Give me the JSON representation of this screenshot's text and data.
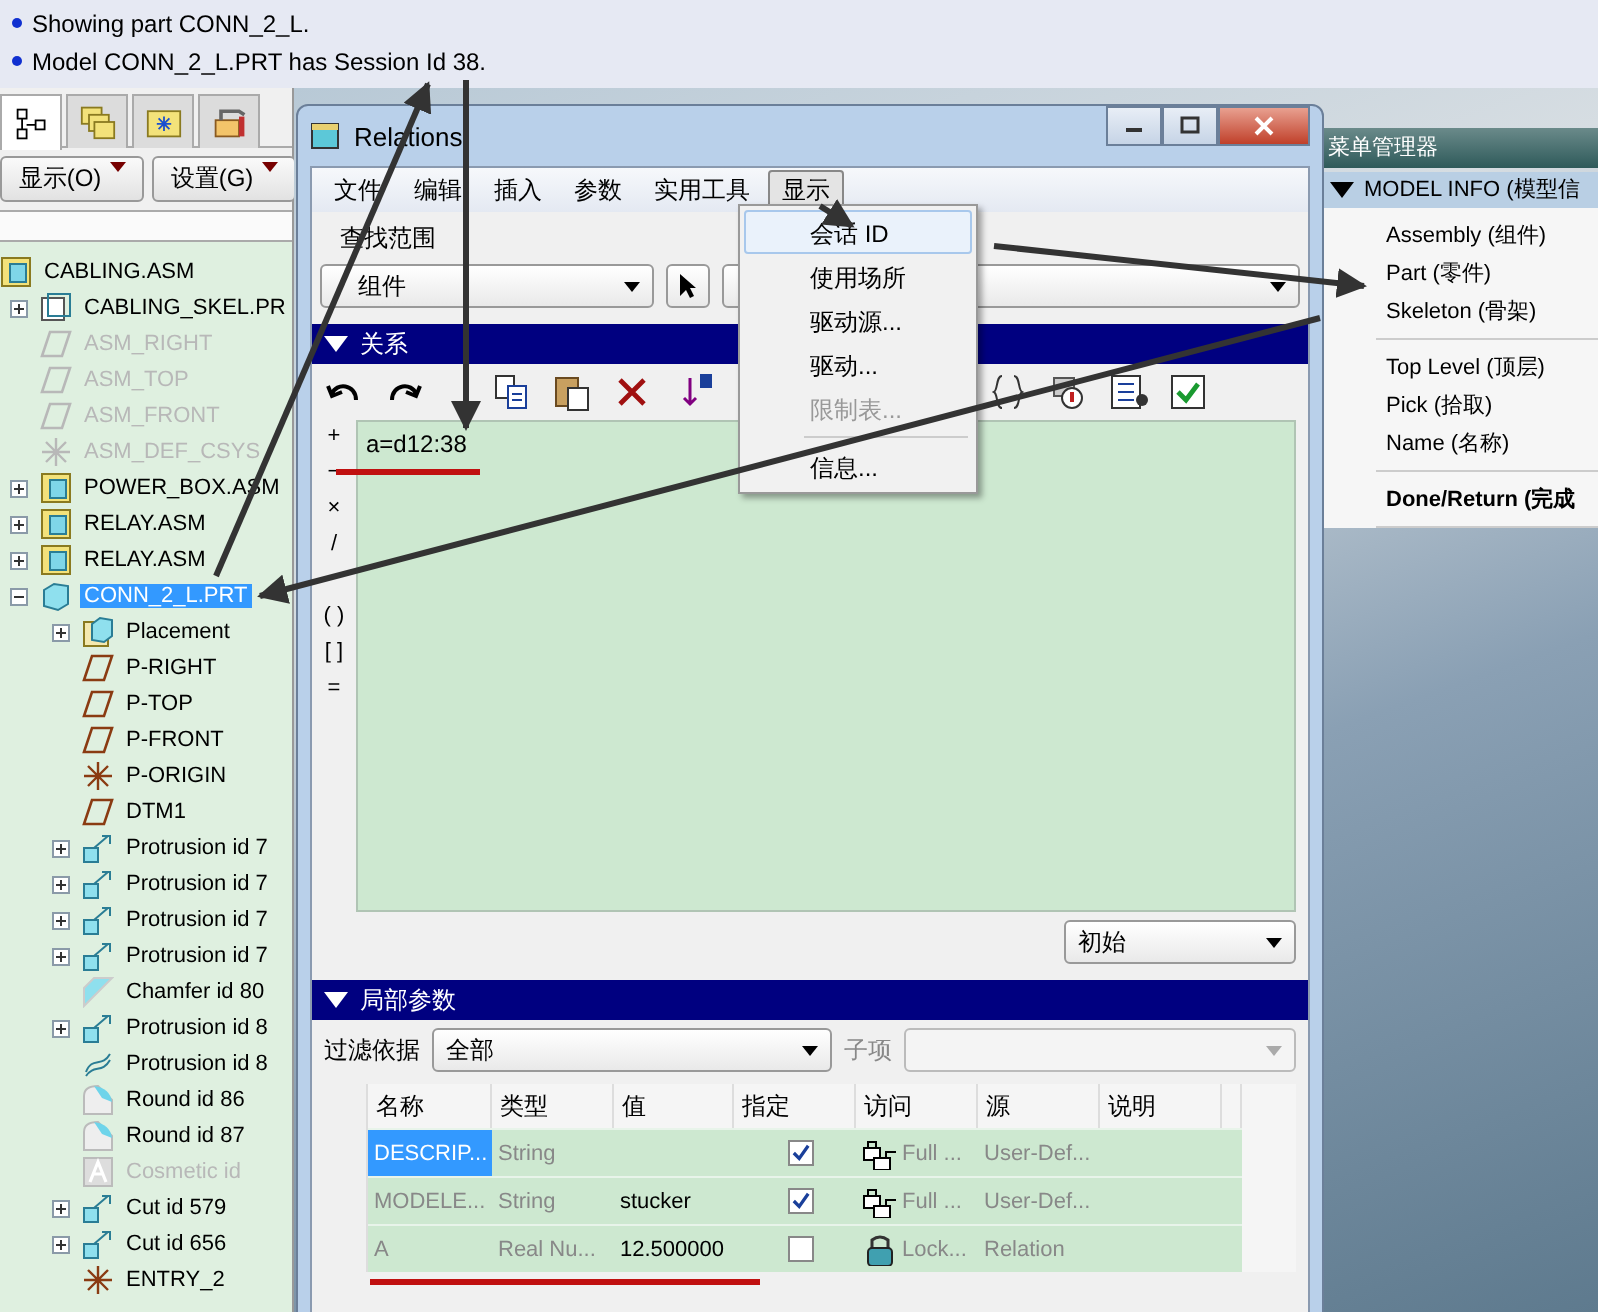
{
  "messages": [
    "Showing part CONN_2_L.",
    "Model CONN_2_L.PRT has Session Id 38."
  ],
  "model_tree": {
    "tabs": [
      {
        "kind": "tree",
        "selected": true
      },
      {
        "kind": "layers",
        "selected": false
      },
      {
        "kind": "favorites",
        "selected": false
      },
      {
        "kind": "tools",
        "selected": false
      }
    ],
    "buttons": [
      "显示(O)",
      "设置(G)"
    ],
    "items": [
      {
        "label": "CABLING.ASM",
        "kind": "asm",
        "selected": false,
        "disabled": false,
        "children": [
          {
            "label": "CABLING_SKEL.PR",
            "kind": "skeleton",
            "expandable": true,
            "expanded": false,
            "selected": false,
            "disabled": false
          },
          {
            "label": "ASM_RIGHT",
            "kind": "plane",
            "selected": false,
            "disabled": true
          },
          {
            "label": "ASM_TOP",
            "kind": "plane",
            "selected": false,
            "disabled": true
          },
          {
            "label": "ASM_FRONT",
            "kind": "plane",
            "selected": false,
            "disabled": true
          },
          {
            "label": "ASM_DEF_CSYS",
            "kind": "csys",
            "selected": false,
            "disabled": true
          },
          {
            "label": "POWER_BOX.ASM",
            "kind": "asm",
            "expandable": true,
            "expanded": false,
            "selected": false,
            "disabled": false
          },
          {
            "label": "RELAY.ASM",
            "kind": "asm",
            "expandable": true,
            "expanded": false,
            "selected": false,
            "disabled": false
          },
          {
            "label": "RELAY.ASM",
            "kind": "asm",
            "expandable": true,
            "expanded": false,
            "selected": false,
            "disabled": false
          },
          {
            "label": "CONN_2_L.PRT",
            "kind": "part",
            "expandable": true,
            "expanded": true,
            "selected": true,
            "disabled": false,
            "children": [
              {
                "label": "Placement",
                "kind": "placement",
                "expandable": true,
                "expanded": false,
                "selected": false,
                "disabled": false
              },
              {
                "label": "P-RIGHT",
                "kind": "plane",
                "selected": false,
                "disabled": false
              },
              {
                "label": "P-TOP",
                "kind": "plane",
                "selected": false,
                "disabled": false
              },
              {
                "label": "P-FRONT",
                "kind": "plane",
                "selected": false,
                "disabled": false
              },
              {
                "label": "P-ORIGIN",
                "kind": "csys",
                "selected": false,
                "disabled": false
              },
              {
                "label": "DTM1",
                "kind": "plane",
                "selected": false,
                "disabled": false
              },
              {
                "label": "Protrusion id 7",
                "kind": "protrusion",
                "expandable": true,
                "expanded": false,
                "selected": false,
                "disabled": false
              },
              {
                "label": "Protrusion id 7",
                "kind": "protrusion",
                "expandable": true,
                "expanded": false,
                "selected": false,
                "disabled": false
              },
              {
                "label": "Protrusion id 7",
                "kind": "protrusion",
                "expandable": true,
                "expanded": false,
                "selected": false,
                "disabled": false
              },
              {
                "label": "Protrusion id 7",
                "kind": "protrusion",
                "expandable": true,
                "expanded": false,
                "selected": false,
                "disabled": false
              },
              {
                "label": "Chamfer id 80",
                "kind": "chamfer",
                "selected": false,
                "disabled": false
              },
              {
                "label": "Protrusion id 8",
                "kind": "protrusion",
                "expandable": true,
                "expanded": false,
                "selected": false,
                "disabled": false
              },
              {
                "label": "Protrusion id 8",
                "kind": "sweep",
                "selected": false,
                "disabled": false
              },
              {
                "label": "Round id 86",
                "kind": "round",
                "selected": false,
                "disabled": false
              },
              {
                "label": "Round id 87",
                "kind": "round",
                "selected": false,
                "disabled": false
              },
              {
                "label": "Cosmetic id",
                "kind": "cosmetic",
                "selected": false,
                "disabled": true
              },
              {
                "label": "Cut id 579",
                "kind": "cut",
                "expandable": true,
                "expanded": false,
                "selected": false,
                "disabled": false
              },
              {
                "label": "Cut id 656",
                "kind": "cut",
                "expandable": true,
                "expanded": false,
                "selected": false,
                "disabled": false
              },
              {
                "label": "ENTRY_2",
                "kind": "csys",
                "selected": false,
                "disabled": false
              }
            ]
          }
        ]
      }
    ]
  },
  "relations_dialog": {
    "title": "Relations",
    "menu": [
      {
        "label": "文件",
        "selected": false
      },
      {
        "label": "编辑",
        "selected": false
      },
      {
        "label": "插入",
        "selected": false
      },
      {
        "label": "参数",
        "selected": false
      },
      {
        "label": "实用工具",
        "selected": false
      },
      {
        "label": "显示",
        "selected": true
      }
    ],
    "lookup": {
      "label": "查找范围",
      "scope": "组件"
    },
    "relations_section": {
      "title": "关系",
      "expanded": true
    },
    "operators": [
      "+",
      "−",
      "×",
      "/",
      "( )",
      "[ ]",
      "="
    ],
    "relations_text": "a=d12:38",
    "mode": "初始",
    "params_section": {
      "title": "局部参数",
      "expanded": true
    },
    "filter": {
      "label": "过滤依据",
      "value": "全部",
      "sub_label": "子项"
    },
    "table": {
      "columns": [
        "名称",
        "类型",
        "值",
        "指定",
        "访问",
        "源",
        "说明"
      ],
      "rows": [
        {
          "name": "DESCRIP...",
          "type": "String",
          "designated": true,
          "access": "Full ...",
          "kind": "full",
          "source": "User-Def...",
          "selected": true
        },
        {
          "name": "MODELE...",
          "type": "String",
          "value": "stucker",
          "designated": true,
          "access": "Full ...",
          "kind": "full",
          "source": "User-Def...",
          "selected": false
        },
        {
          "name": "A",
          "type": "Real Nu...",
          "value": "12.500000",
          "designated": false,
          "access": "Lock...",
          "kind": "locked",
          "source": "Relation",
          "selected": false
        }
      ]
    }
  },
  "show_menu": {
    "items": [
      {
        "kind": "item",
        "label": "会话 ID",
        "selected": true,
        "disabled": false
      },
      {
        "kind": "item",
        "label": "使用场所",
        "selected": false,
        "disabled": false
      },
      {
        "kind": "item",
        "label": "驱动源...",
        "selected": false,
        "disabled": false
      },
      {
        "kind": "item",
        "label": "驱动...",
        "selected": false,
        "disabled": false
      },
      {
        "kind": "item",
        "label": "限制表...",
        "selected": false,
        "disabled": true
      },
      {
        "kind": "separator"
      },
      {
        "kind": "item",
        "label": "信息...",
        "selected": false,
        "disabled": false
      }
    ]
  },
  "menu_manager": {
    "title": "菜单管理器",
    "header": "MODEL INFO (模型信",
    "groups": [
      [
        {
          "kind": "option",
          "label": "Assembly (组件)"
        },
        {
          "kind": "option",
          "label": "Part (零件)"
        },
        {
          "kind": "option",
          "label": "Skeleton (骨架)"
        }
      ],
      [
        {
          "kind": "option",
          "label": "Top Level (顶层)"
        },
        {
          "kind": "option",
          "label": "Pick (拾取)"
        },
        {
          "kind": "option",
          "label": "Name (名称)"
        }
      ],
      [
        {
          "kind": "done",
          "label": "Done/Return (完成"
        }
      ]
    ]
  }
}
